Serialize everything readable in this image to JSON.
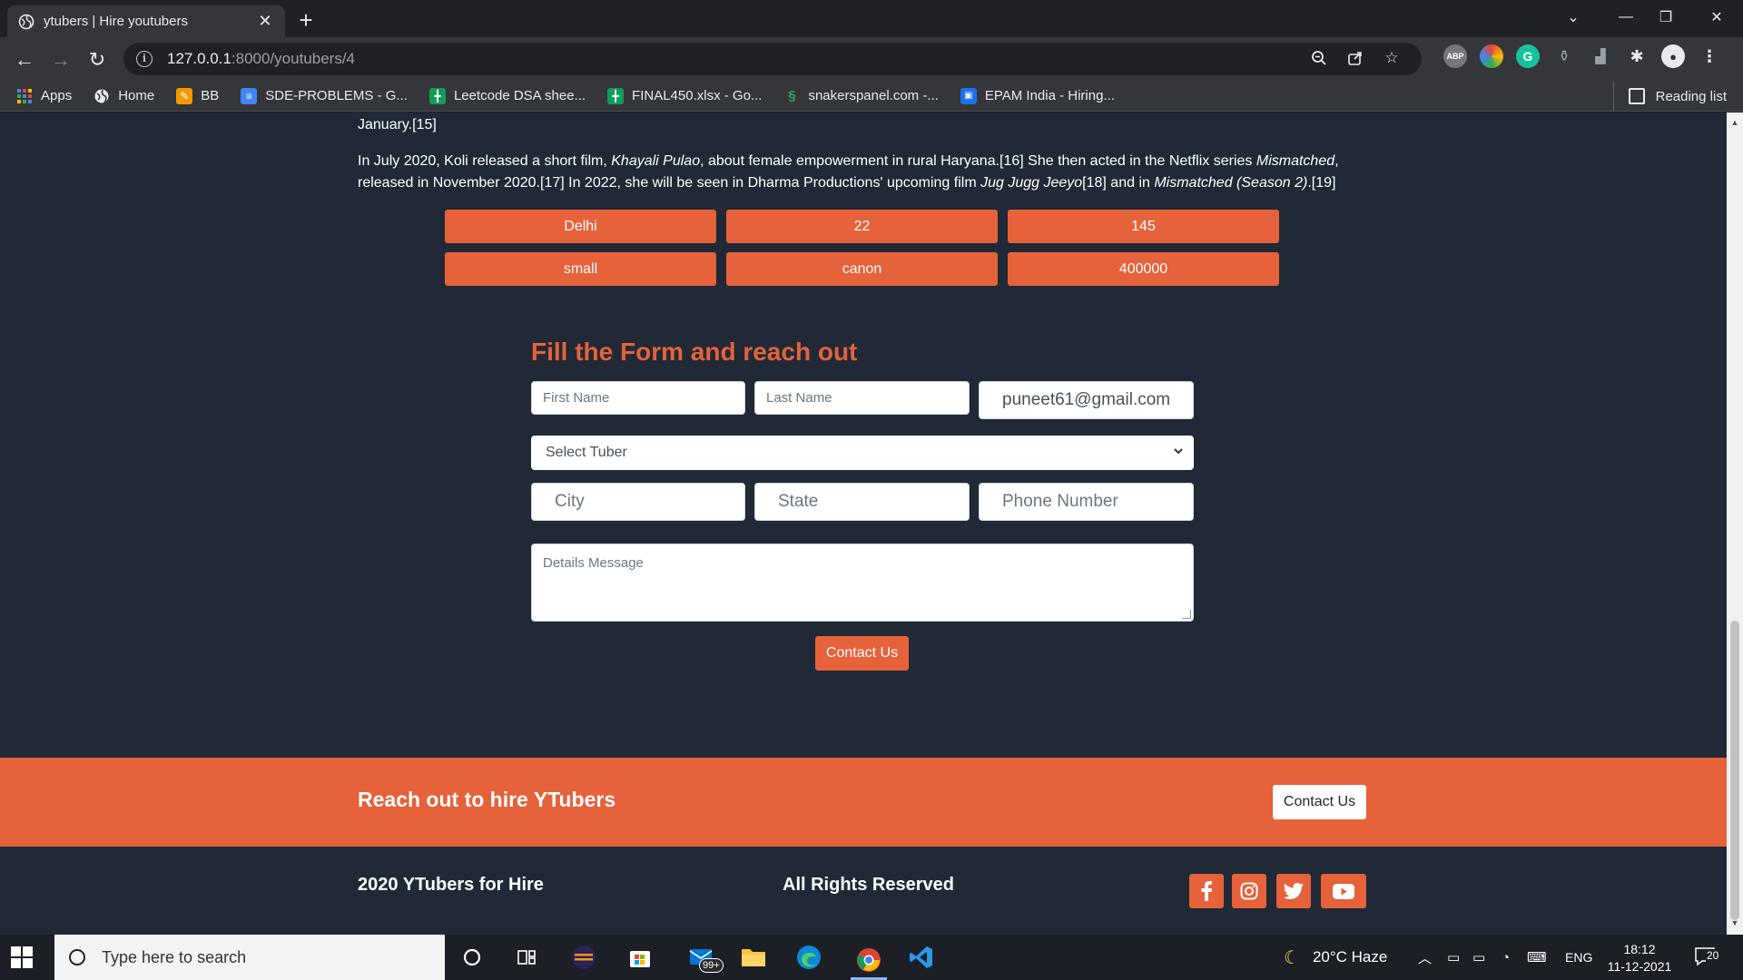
{
  "browser": {
    "tab_title": "ytubers | Hire youtubers",
    "url_host": "127.0.0.1",
    "url_path": ":8000/youtubers/4",
    "bookmarks": [
      {
        "label": "Apps",
        "icon": "apps-grid-icon",
        "color": "#4285f4"
      },
      {
        "label": "Home",
        "icon": "globe-icon",
        "color": "#e8eaed"
      },
      {
        "label": "BB",
        "icon": "bookmark-orange-icon",
        "color": "#f29900"
      },
      {
        "label": "SDE-PROBLEMS - G...",
        "icon": "google-docs-icon",
        "color": "#4285f4"
      },
      {
        "label": "Leetcode DSA shee...",
        "icon": "google-sheets-icon",
        "color": "#0f9d58"
      },
      {
        "label": "FINAL450.xlsx - Go...",
        "icon": "google-sheets-icon",
        "color": "#0f9d58"
      },
      {
        "label": "snakerspanel.com -...",
        "icon": "snake-icon",
        "color": "#34a853"
      },
      {
        "label": "EPAM India - Hiring...",
        "icon": "epam-icon",
        "color": "#1a73e8"
      }
    ],
    "reading_list": "Reading list"
  },
  "bio": {
    "line0": "January.[15]",
    "p1_a": "In July 2020, Koli released a short film, ",
    "p1_em1": "Khayali Pulao",
    "p1_b": ", about female empowerment in rural Haryana.[16] She then acted in the Netflix series ",
    "p1_em2": "Mismatched",
    "p1_c": ",",
    "p2_a": "released in November 2020.[17] In 2022, she will be seen in Dharma Productions' upcoming film ",
    "p2_em1": "Jug Jugg Jeeyo",
    "p2_b": "[18] and in ",
    "p2_em2": "Mismatched (Season 2)",
    "p2_c": ".[19]"
  },
  "info": [
    "Delhi",
    "22",
    "145",
    "small",
    "canon",
    "400000"
  ],
  "form": {
    "title": "Fill the Form and reach out",
    "first_name_placeholder": "First Name",
    "last_name_placeholder": "Last Name",
    "email_value": "puneet61@gmail.com",
    "select_value": "Select Tuber",
    "city_placeholder": "City",
    "state_placeholder": "State",
    "phone_placeholder": "Phone Number",
    "message_placeholder": "Details Message",
    "submit_label": "Contact Us"
  },
  "banner": {
    "title": "Reach out to hire YTubers",
    "button_label": "Contact Us"
  },
  "footer": {
    "left": "2020 YTubers for Hire",
    "middle": "All Rights Reserved",
    "social": [
      "facebook-icon",
      "instagram-icon",
      "twitter-icon",
      "youtube-icon"
    ]
  },
  "taskbar": {
    "search_placeholder": "Type here to search",
    "mail_badge": "99+",
    "weather": "20°C  Haze",
    "language": "ENG",
    "time": "18:12",
    "date": "11-12-2021",
    "notifications": "20"
  },
  "colors": {
    "accent": "#e5623a",
    "page_bg": "#212936"
  }
}
